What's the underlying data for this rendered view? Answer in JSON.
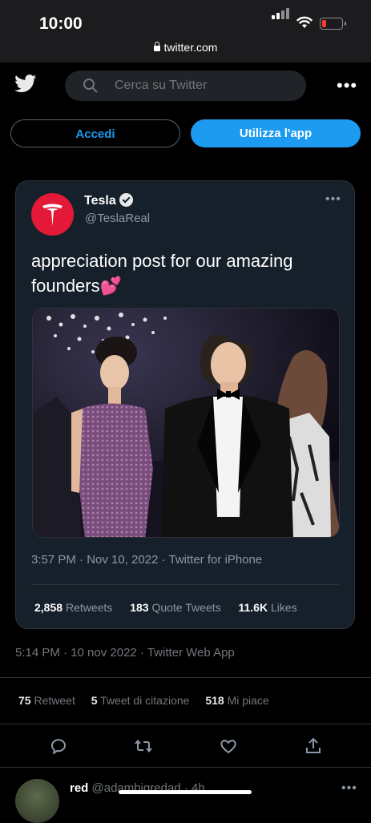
{
  "status_bar": {
    "time": "10:00",
    "url": "twitter.com"
  },
  "search": {
    "placeholder": "Cerca su Twitter"
  },
  "buttons": {
    "login": "Accedi",
    "use_app": "Utilizza l'app"
  },
  "embedded_tweet": {
    "author_name": "Tesla",
    "author_handle": "@TeslaReal",
    "text": "appreciation post for our amazing founders",
    "emoji": "💕",
    "meta": "3:57 PM · Nov 10, 2022 · Twitter for iPhone",
    "retweets_count": "2,858",
    "retweets_label": "Retweets",
    "quotes_count": "183",
    "quotes_label": "Quote Tweets",
    "likes_count": "11.6K",
    "likes_label": "Likes"
  },
  "tweet": {
    "meta": "5:14 PM · 10 nov 2022 · Twitter Web App",
    "retweets_count": "75",
    "retweets_label": "Retweet",
    "quotes_count": "5",
    "quotes_label": "Tweet di citazione",
    "likes_count": "518",
    "likes_label": "Mi piace"
  },
  "reply": {
    "name": "red",
    "handle_time": "@adambigredad · 4h"
  },
  "icons": [
    "twitter-bird-icon",
    "search-icon",
    "more-icon",
    "verified-icon",
    "reply-icon",
    "retweet-icon",
    "like-icon",
    "share-icon"
  ],
  "colors": {
    "accent": "#1d9bf0",
    "tesla_red": "#e31937",
    "background": "#000000",
    "card": "#15202b"
  }
}
